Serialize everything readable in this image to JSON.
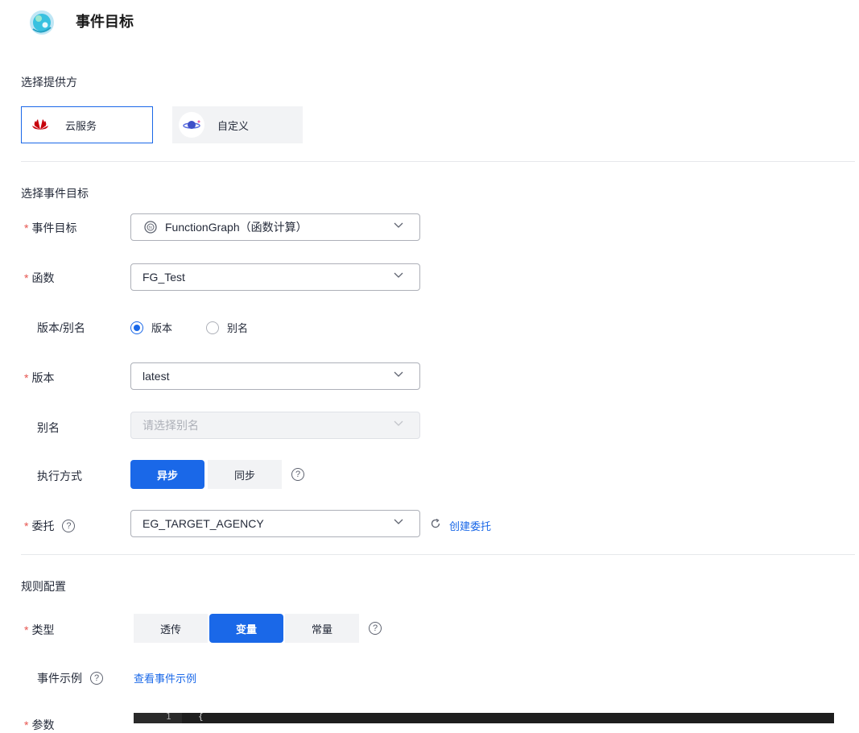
{
  "header": {
    "title": "事件目标"
  },
  "provider": {
    "section_title": "选择提供方",
    "options": [
      {
        "label": "云服务",
        "icon": "huawei-logo-icon",
        "selected": true
      },
      {
        "label": "自定义",
        "icon": "planet-icon",
        "selected": false
      }
    ]
  },
  "target": {
    "section_title": "选择事件目标",
    "event_target": {
      "label": "事件目标",
      "value": "FunctionGraph（函数计算）",
      "icon": "function-graph-icon"
    },
    "function": {
      "label": "函数",
      "value": "FG_Test"
    },
    "version_alias": {
      "label": "版本/别名",
      "options": [
        "版本",
        "别名"
      ],
      "selected": "版本"
    },
    "version": {
      "label": "版本",
      "value": "latest"
    },
    "alias": {
      "label": "别名",
      "placeholder": "请选择别名"
    },
    "exec_mode": {
      "label": "执行方式",
      "options": [
        "异步",
        "同步"
      ],
      "selected": "异步"
    },
    "agency": {
      "label": "委托",
      "value": "EG_TARGET_AGENCY",
      "create_link": "创建委托"
    }
  },
  "rule": {
    "section_title": "规则配置",
    "type": {
      "label": "类型",
      "options": [
        "透传",
        "变量",
        "常量"
      ],
      "selected": "变量"
    },
    "example": {
      "label": "事件示例",
      "link": "查看事件示例"
    },
    "params": {
      "label": "参数",
      "line_number": "1",
      "code_first_line": "{"
    }
  },
  "colors": {
    "primary": "#1a68e8",
    "required": "#e6544e",
    "huawei_red": "#c7000b"
  }
}
